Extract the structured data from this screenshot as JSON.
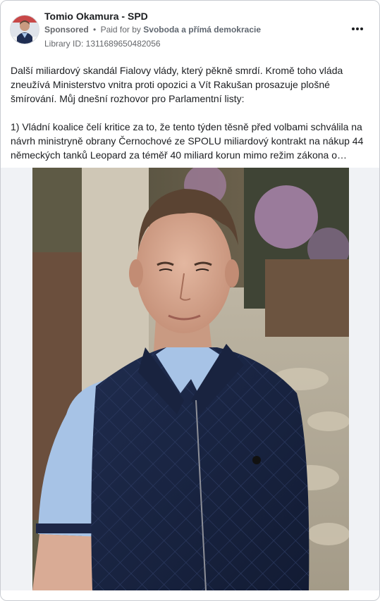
{
  "post": {
    "page_name": "Tomio Okamura - SPD",
    "sponsored_label": "Sponsored",
    "separator": "•",
    "paid_for_prefix": "Paid for by",
    "payer": "Svoboda a přímá demokracie",
    "library_id": "Library ID: 1311689650482056",
    "more_icon": "more-horizontal-icon",
    "text_paragraphs": [
      "Další miliardový skandál Fialovy vlády, který pěkně smrdí. Kromě toho vláda zneužívá Ministerstvo vnitra proti opozici a Vít Rakušan prosazuje plošné šmírování. Můj dnešní rozhovor pro Parlamentní listy:",
      "1) Vládní koalice čelí kritice za to, že tento týden těsně před volbami schválila na návrh ministryně obrany Černochové ze SPOLU miliardový kontrakt na nákup 44 německých tanků Leopard za téměř 40 miliard korun mimo režim zákona o…"
    ]
  },
  "colors": {
    "border": "#c9ccd1",
    "text": "#1c1e21",
    "meta": "#65676b",
    "media_background": "#f0f2f5"
  }
}
